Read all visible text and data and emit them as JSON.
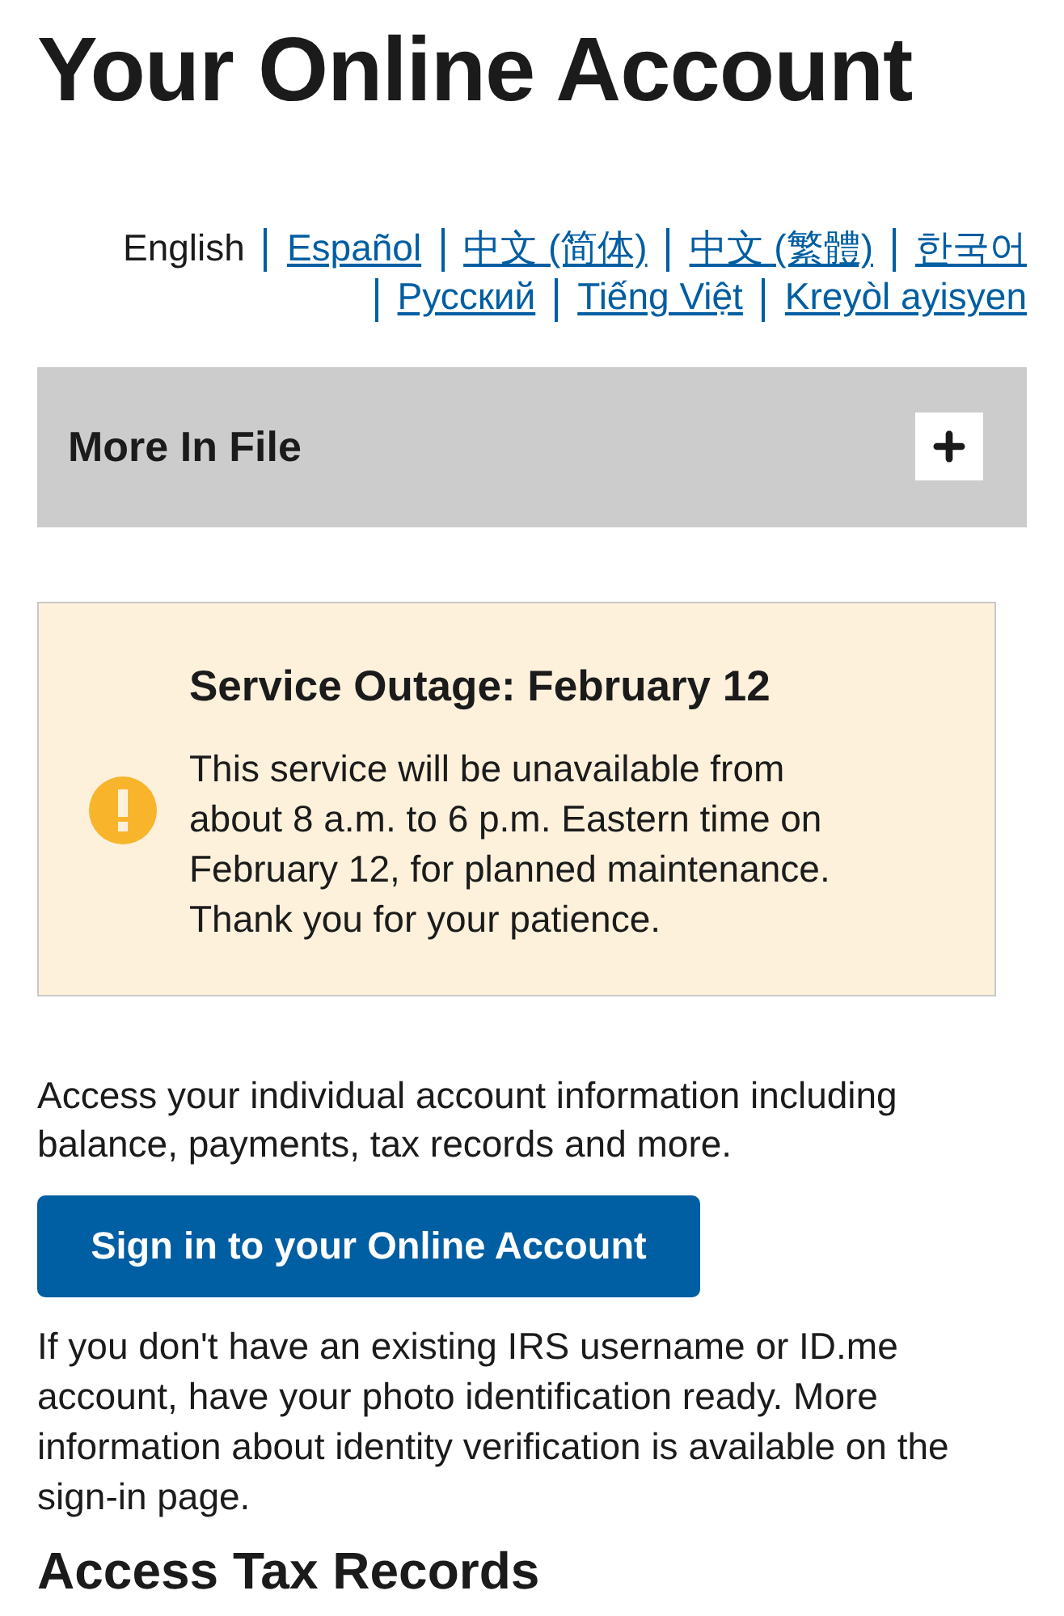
{
  "page_title": "Your Online Account",
  "languages": [
    {
      "label": "English",
      "selected": true
    },
    {
      "label": "Español",
      "selected": false
    },
    {
      "label": "中文 (简体)",
      "selected": false
    },
    {
      "label": "中文 (繁體)",
      "selected": false
    },
    {
      "label": "한국어",
      "selected": false
    },
    {
      "label": "Русский",
      "selected": false
    },
    {
      "label": "Tiếng Việt",
      "selected": false
    },
    {
      "label": "Kreyòl ayisyen",
      "selected": false
    }
  ],
  "accordion": {
    "title": "More In File",
    "expanded": false
  },
  "alert": {
    "title": "Service Outage: February 12",
    "body": "This service will be unavailable from about 8 a.m. to 6 p.m. Eastern time on February 12, for planned maintenance. Thank you for your patience."
  },
  "intro": "Access your individual account information including balance, payments, tax records and more.",
  "sign_in_button": "Sign in to your Online Account",
  "note": "If you don't have an existing IRS username or ID.me account, have your photo identification ready. More information about identity verification is available on the sign-in page.",
  "next_heading": "Access Tax Records"
}
